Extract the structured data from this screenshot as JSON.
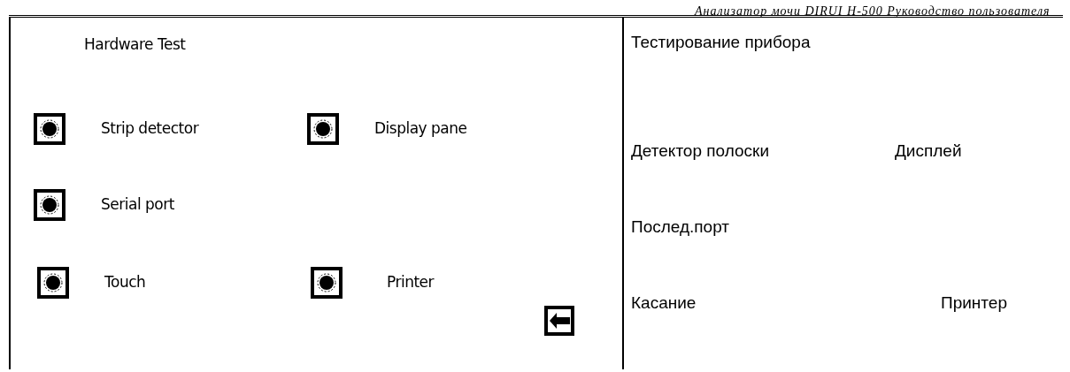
{
  "header": {
    "text": "Анализатор мочи DIRUI H-500 Руководство пользователя"
  },
  "device_screen": {
    "title": "Hardware Test",
    "rows": [
      {
        "tests": [
          {
            "label": "Strip detector"
          },
          {
            "label": "Display pane"
          }
        ]
      },
      {
        "tests": [
          {
            "label": "Serial port"
          }
        ]
      },
      {
        "tests": [
          {
            "label": "Touch"
          },
          {
            "label": "Printer"
          }
        ]
      }
    ]
  },
  "translation": {
    "title": "Тестирование прибора",
    "rows": [
      {
        "labels": [
          "Детектор полоски",
          "Дисплей"
        ]
      },
      {
        "labels": [
          "Послед.порт"
        ]
      },
      {
        "labels": [
          "Касание",
          "Принтер"
        ]
      }
    ]
  }
}
